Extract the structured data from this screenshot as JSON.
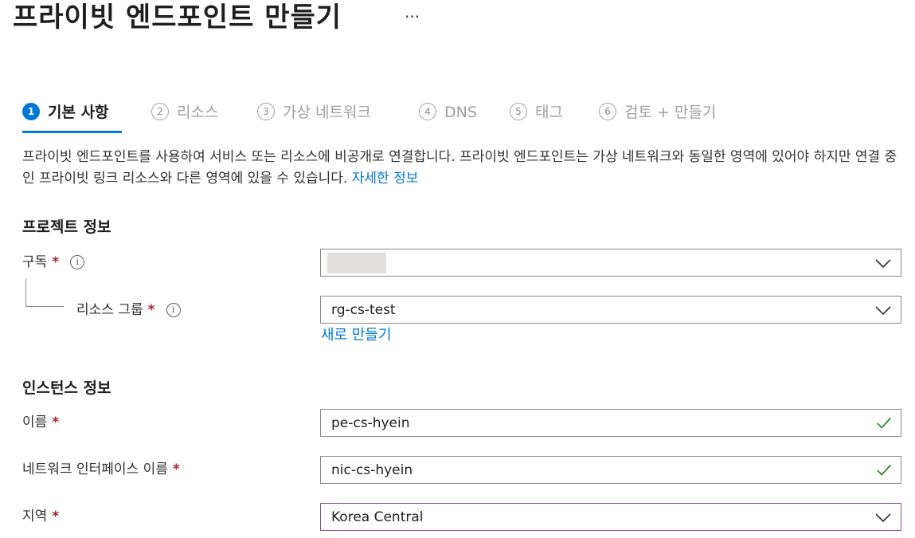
{
  "header": {
    "title": "프라이빗 엔드포인트 만들기",
    "more_label": "···"
  },
  "steps": [
    {
      "number": "1",
      "label": "기본 사항",
      "active": true
    },
    {
      "number": "2",
      "label": "리소스",
      "active": false
    },
    {
      "number": "3",
      "label": "가상 네트워크",
      "active": false
    },
    {
      "number": "4",
      "label": "DNS",
      "active": false
    },
    {
      "number": "5",
      "label": "태그",
      "active": false
    },
    {
      "number": "6",
      "label": "검토 + 만들기",
      "active": false
    }
  ],
  "description": {
    "text": "프라이빗 엔드포인트를 사용하여 서비스 또는 리소스에 비공개로 연결합니다. 프라이빗 엔드포인트는 가상 네트워크와 동일한 영역에 있어야 하지만 연결 중인 프라이빗 링크 리소스와 다른 영역에 있을 수 있습니다.",
    "link": "자세한 정보"
  },
  "project": {
    "title": "프로젝트 정보",
    "subscription_label": "구독",
    "subscription_value": "",
    "resource_group_label": "리소스 그룹",
    "resource_group_value": "rg-cs-test",
    "create_new_link": "새로 만들기"
  },
  "instance": {
    "title": "인스턴스 정보",
    "name_label": "이름",
    "name_value": "pe-cs-hyein",
    "nic_label": "네트워크 인터페이스 이름",
    "nic_value": "nic-cs-hyein",
    "region_label": "지역",
    "region_value": "Korea Central"
  },
  "required_mark": "*",
  "info_glyph": "i",
  "colors": {
    "accent": "#0078d4",
    "required": "#a4262c",
    "valid": "#107c10",
    "focus": "#8a4c8e"
  }
}
